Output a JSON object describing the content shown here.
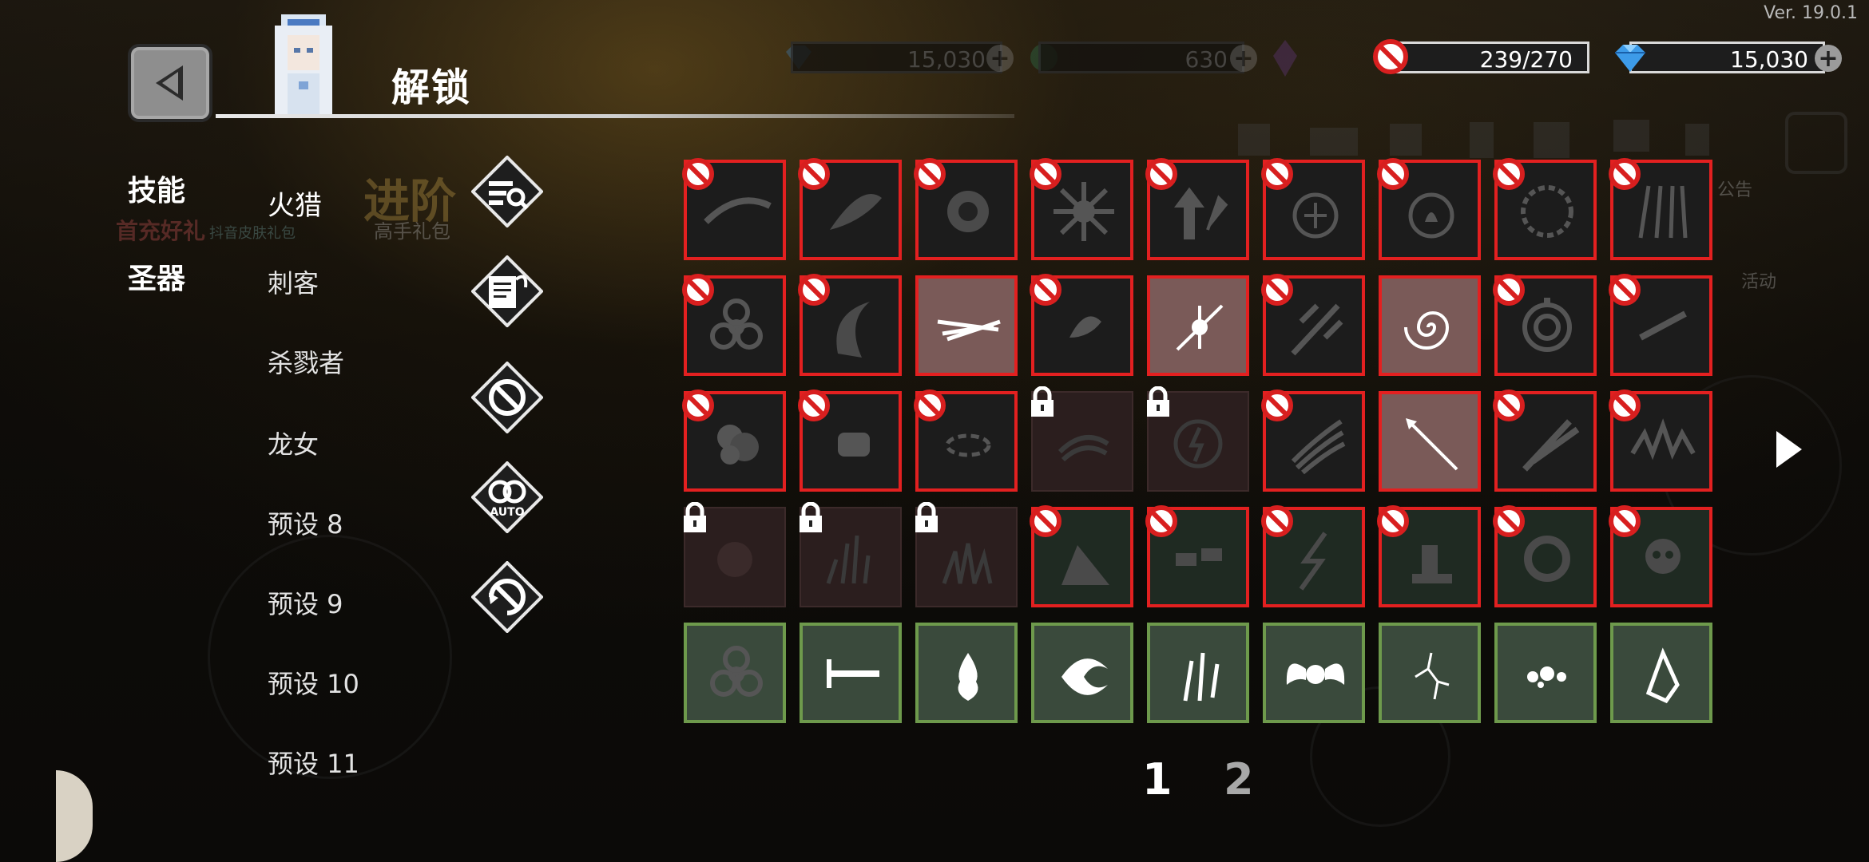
{
  "version": "Ver. 19.0.1",
  "title": "解锁",
  "resources": {
    "gem_dim": "15,030",
    "green_dim": "630",
    "stamina": "239/270",
    "gem": "15,030"
  },
  "menu": {
    "categories": [
      "技能",
      "圣器"
    ],
    "presets": [
      "火猎",
      "刺客",
      "杀戮者",
      "龙女",
      "预设 8",
      "预设 9",
      "预设 10",
      "预设 11"
    ]
  },
  "bg_text": {
    "advance": "进阶",
    "advance_sub": "高手礼包",
    "left_promo": "首充好礼",
    "left_promo2": "抖音皮肤礼包",
    "notice": "公告",
    "activity": "活动"
  },
  "pages": [
    "1",
    "2"
  ],
  "current_page": "1",
  "side_icons": [
    "search-list-icon",
    "scroll-icon",
    "ban-icon",
    "auto-ring-icon",
    "ban-refresh-icon"
  ],
  "grid": {
    "rows": [
      [
        {
          "state": "banned",
          "icon": "slash"
        },
        {
          "state": "banned",
          "icon": "blade"
        },
        {
          "state": "banned",
          "icon": "burst"
        },
        {
          "state": "banned",
          "icon": "splat"
        },
        {
          "state": "banned",
          "icon": "arrows-up"
        },
        {
          "state": "banned",
          "icon": "snow-orb"
        },
        {
          "state": "banned",
          "icon": "fire-orb"
        },
        {
          "state": "banned",
          "icon": "vortex-ring"
        },
        {
          "state": "banned",
          "icon": "spears"
        }
      ],
      [
        {
          "state": "banned",
          "icon": "biohazard"
        },
        {
          "state": "banned",
          "icon": "crescent"
        },
        {
          "state": "selected",
          "icon": "streaks"
        },
        {
          "state": "banned",
          "icon": "feather"
        },
        {
          "state": "selected",
          "icon": "spark-cross"
        },
        {
          "state": "banned",
          "icon": "frost-sword"
        },
        {
          "state": "selected",
          "icon": "spiral"
        },
        {
          "state": "banned",
          "icon": "target"
        },
        {
          "state": "banned",
          "icon": "dagger"
        }
      ],
      [
        {
          "state": "banned",
          "icon": "smoke"
        },
        {
          "state": "banned",
          "icon": "fist"
        },
        {
          "state": "banned",
          "icon": "ring-dash"
        },
        {
          "state": "locked",
          "icon": "feathers"
        },
        {
          "state": "locked",
          "icon": "thunder-orb"
        },
        {
          "state": "banned",
          "icon": "claw"
        },
        {
          "state": "selected",
          "icon": "spear"
        },
        {
          "state": "banned",
          "icon": "slash-x"
        },
        {
          "state": "banned",
          "icon": "spikes"
        }
      ],
      [
        {
          "state": "locked",
          "icon": "fireball"
        },
        {
          "state": "locked",
          "icon": "grass"
        },
        {
          "state": "locked",
          "icon": "flame-grass"
        },
        {
          "state": "banned-green",
          "icon": "ramp"
        },
        {
          "state": "banned-green",
          "icon": "chain"
        },
        {
          "state": "banned-green",
          "icon": "lightning"
        },
        {
          "state": "banned-green",
          "icon": "kneel"
        },
        {
          "state": "banned-green",
          "icon": "fire-swirl"
        },
        {
          "state": "banned-green",
          "icon": "skull"
        }
      ],
      [
        {
          "state": "owned",
          "icon": "biohazard"
        },
        {
          "state": "owned",
          "icon": "sword"
        },
        {
          "state": "owned",
          "icon": "flame-drop"
        },
        {
          "state": "owned",
          "icon": "reap"
        },
        {
          "state": "owned",
          "icon": "daggers"
        },
        {
          "state": "owned",
          "icon": "winged-orb"
        },
        {
          "state": "owned",
          "icon": "crack"
        },
        {
          "state": "owned",
          "icon": "splatter"
        },
        {
          "state": "owned",
          "icon": "crystal"
        }
      ]
    ]
  },
  "colors": {
    "ban_red": "#e32020",
    "owned_green": "#6e9a4c",
    "selected_bg": "#7a5a58"
  }
}
